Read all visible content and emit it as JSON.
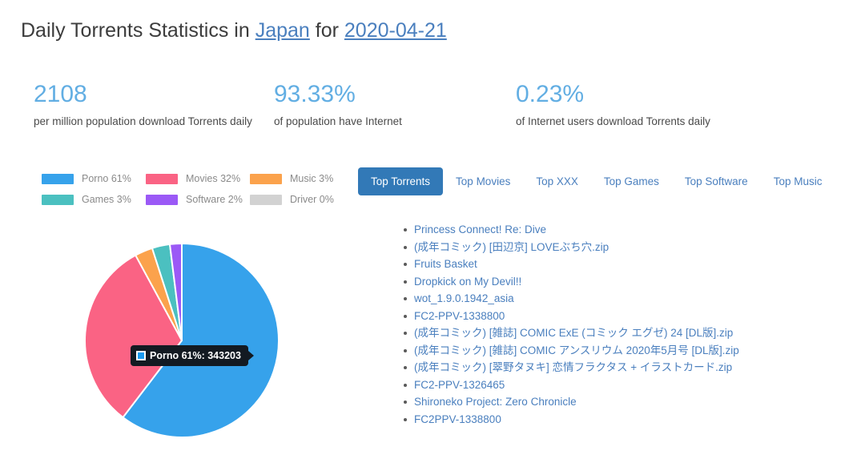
{
  "header": {
    "prefix": "Daily Torrents Statistics in ",
    "country": "Japan",
    "middle": " for ",
    "date": "2020-04-21"
  },
  "stats": [
    {
      "value": "2108",
      "label": "per million population download Torrents daily"
    },
    {
      "value": "93.33%",
      "label": "of population have Internet"
    },
    {
      "value": "0.23%",
      "label": "of Internet users download Torrents daily"
    }
  ],
  "legend": [
    {
      "label": "Porno 61%",
      "color": "#36a2eb"
    },
    {
      "label": "Movies 32%",
      "color": "#fa6384"
    },
    {
      "label": "Music 3%",
      "color": "#fba24c"
    },
    {
      "label": "Games 3%",
      "color": "#4bc0c0"
    },
    {
      "label": "Software 2%",
      "color": "#9b59f6"
    },
    {
      "label": "Driver 0%",
      "color": "#d2d2d2"
    }
  ],
  "tooltip": {
    "swatch_color": "#1b9bf0",
    "text": "Porno 61%: 343203"
  },
  "tabs": [
    {
      "label": "Top Torrents",
      "active": true
    },
    {
      "label": "Top Movies",
      "active": false
    },
    {
      "label": "Top XXX",
      "active": false
    },
    {
      "label": "Top Games",
      "active": false
    },
    {
      "label": "Top Software",
      "active": false
    },
    {
      "label": "Top Music",
      "active": false
    }
  ],
  "torrents": [
    "Princess Connect! Re: Dive",
    "(成年コミック) [田辺京] LOVEぶち穴.zip",
    "Fruits Basket",
    "Dropkick on My Devil!!",
    "wot_1.9.0.1942_asia",
    "FC2-PPV-1338800",
    "(成年コミック) [雑誌] COMIC ExE (コミック エグゼ) 24 [DL版].zip",
    "(成年コミック) [雑誌] COMIC アンスリウム 2020年5月号 [DL版].zip",
    "(成年コミック) [翠野タヌキ] 恋情フラクタス + イラストカード.zip",
    "FC2-PPV-1326465",
    "Shironeko Project: Zero Chronicle",
    "FC2PPV-1338800"
  ],
  "chart_data": {
    "type": "pie",
    "title": "",
    "labels": [
      "Porno",
      "Movies",
      "Music",
      "Games",
      "Software",
      "Driver"
    ],
    "percentages": [
      61,
      32,
      3,
      3,
      2,
      0
    ],
    "values": [
      343203,
      null,
      null,
      null,
      null,
      null
    ],
    "colors": [
      "#36a2eb",
      "#fa6384",
      "#fba24c",
      "#4bc0c0",
      "#9b59f6",
      "#d2d2d2"
    ],
    "legend_position": "top-left",
    "start_angle_deg": 0,
    "direction": "clockwise",
    "hovered_slice": "Porno",
    "hover_tooltip": "Porno 61%: 343203"
  },
  "theme": {
    "link_color": "#4a7fbe",
    "stat_color": "#62aee3",
    "active_tab_bg": "#3279b7",
    "text_color": "#3c3c3c"
  }
}
